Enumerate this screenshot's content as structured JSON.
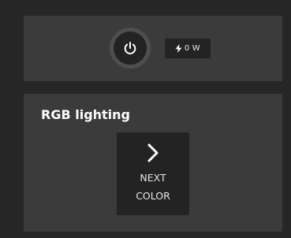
{
  "power_card": {
    "watt_value": "0",
    "watt_unit": "W"
  },
  "rgb_card": {
    "title": "RGB lighting",
    "next_color_line1": "NEXT",
    "next_color_line2": "COLOR"
  },
  "icons": {
    "power": "power-icon",
    "bolt": "lightning-bolt-icon",
    "next": "chevron-right-icon"
  },
  "colors": {
    "background": "#262626",
    "card": "#3b3b3b",
    "control": "#232323",
    "ring": "#4e4e4e",
    "text": "#ffffff"
  }
}
